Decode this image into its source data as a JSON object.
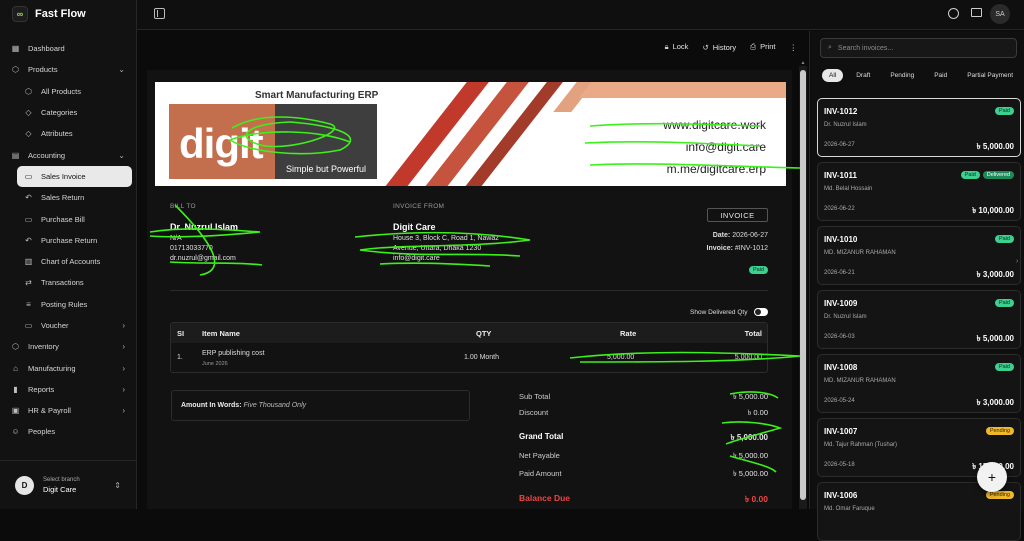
{
  "app": {
    "name": "Fast Flow"
  },
  "sidebar": {
    "items": [
      {
        "label": "Dashboard",
        "icon": "grid-icon"
      },
      {
        "label": "Products",
        "icon": "box-icon",
        "chev": "⌄"
      },
      {
        "label": "All Products",
        "icon": "box-icon",
        "sub": true
      },
      {
        "label": "Categories",
        "icon": "tag-icon",
        "sub": true
      },
      {
        "label": "Attributes",
        "icon": "tag-icon",
        "sub": true
      },
      {
        "label": "Accounting",
        "icon": "calculator-icon",
        "chev": "⌄"
      },
      {
        "label": "Sales Invoice",
        "icon": "document-icon",
        "sub": true,
        "active": true
      },
      {
        "label": "Sales Return",
        "icon": "return-icon",
        "sub": true
      },
      {
        "label": "Purchase Bill",
        "icon": "document-icon",
        "sub": true
      },
      {
        "label": "Purchase Return",
        "icon": "return-icon",
        "sub": true
      },
      {
        "label": "Chart of Accounts",
        "icon": "book-icon",
        "sub": true
      },
      {
        "label": "Transactions",
        "icon": "swap-icon",
        "sub": true
      },
      {
        "label": "Posting Rules",
        "icon": "rules-icon",
        "sub": true
      },
      {
        "label": "Voucher",
        "icon": "document-icon",
        "sub": true,
        "chev": "›"
      },
      {
        "label": "Inventory",
        "icon": "box-icon",
        "chev": "›"
      },
      {
        "label": "Manufacturing",
        "icon": "factory-icon",
        "chev": "›"
      },
      {
        "label": "Reports",
        "icon": "chart-icon",
        "chev": "›"
      },
      {
        "label": "HR & Payroll",
        "icon": "briefcase-icon",
        "chev": "›"
      },
      {
        "label": "Peoples",
        "icon": "users-icon"
      }
    ],
    "branch": {
      "avatar": "D",
      "caption": "Select branch",
      "name": "Digit Care"
    }
  },
  "topbar": {
    "avatar": "SA"
  },
  "actions": {
    "lock": "Lock",
    "history": "History",
    "print": "Print"
  },
  "banner": {
    "tagline": "Smart Manufacturing ERP",
    "logo": "digit",
    "slogan": "Simple but Powerful",
    "web": "www.digitcare.work",
    "email": "info@digit.care",
    "social": "m.me/digitcare.erp"
  },
  "invoice": {
    "bill_to_label": "BILL TO",
    "bill_to": {
      "name": "Dr. Nuzrul Islam",
      "line2": "N/A",
      "phone": "01713033770",
      "email": "dr.nuzrul@gmail.com"
    },
    "from_label": "INVOICE FROM",
    "from": {
      "name": "Digit Care",
      "addr1": "House 3, Block C, Road 1, Nawaz",
      "addr2": "Avenue, Uttara, Dhaka 1230",
      "email": "info@digit.care"
    },
    "badge": "INVOICE",
    "date_label": "Date:",
    "date": "2026-06-27",
    "no_label": "Invoice:",
    "no": "#INV-1012",
    "status": "Paid",
    "toggle_label": "Show Delivered Qty",
    "columns": {
      "si": "SI",
      "item": "Item Name",
      "qty": "QTY",
      "rate": "Rate",
      "total": "Total"
    },
    "rows": [
      {
        "si": "1.",
        "item": "ERP publishing cost",
        "sub": "June 2026",
        "qty": "1.00 Month",
        "rate": "5,000.00",
        "total": "5,000.00"
      }
    ],
    "words_label": "Amount In Words:",
    "words": "Five Thousand Only",
    "totals": [
      {
        "label": "Sub Total",
        "value": "৳ 5,000.00"
      },
      {
        "label": "Discount",
        "value": "৳ 0.00"
      },
      {
        "label": "Grand Total",
        "value": "৳ 5,000.00",
        "bold": true
      },
      {
        "label": "Net Payable",
        "value": "৳ 5,000.00"
      },
      {
        "label": "Paid Amount",
        "value": "৳ 5,000.00"
      },
      {
        "label": "Balance Due",
        "value": "৳ 0.00",
        "due": true
      }
    ]
  },
  "right_panel": {
    "search_placeholder": "Search invoices...",
    "filters": [
      "All",
      "Draft",
      "Pending",
      "Paid",
      "Partial Payment"
    ],
    "cards": [
      {
        "no": "INV-1012",
        "customer": "Dr. Nuzrul Islam",
        "date": "2026-06-27",
        "amount": "৳ 5,000.00",
        "pills": [
          "Paid"
        ],
        "selected": true
      },
      {
        "no": "INV-1011",
        "customer": "Md. Belal Hossain",
        "date": "2026-06-22",
        "amount": "৳ 10,000.00",
        "pills": [
          "Paid",
          "Delivered"
        ]
      },
      {
        "no": "INV-1010",
        "customer": "MD. MIZANUR RAHAMAN",
        "date": "2026-06-21",
        "amount": "৳ 3,000.00",
        "pills": [
          "Paid"
        ]
      },
      {
        "no": "INV-1009",
        "customer": "Dr. Nuzrul Islam",
        "date": "2026-06-03",
        "amount": "৳ 5,000.00",
        "pills": [
          "Paid"
        ]
      },
      {
        "no": "INV-1008",
        "customer": "MD. MIZANUR RAHAMAN",
        "date": "2026-05-24",
        "amount": "৳ 3,000.00",
        "pills": [
          "Paid"
        ]
      },
      {
        "no": "INV-1007",
        "customer": "Md. Tajur Rahman (Tushar)",
        "date": "2026-05-18",
        "amount": "৳ 15,000.00",
        "pills": [
          "Pending"
        ]
      },
      {
        "no": "INV-1006",
        "customer": "Md. Omar Faruque",
        "date": "",
        "amount": "",
        "pills": [
          "Pending"
        ]
      }
    ]
  },
  "colors": {
    "paid": "#3ccf8e",
    "pending": "#f0b92a",
    "due": "#ef4444"
  }
}
